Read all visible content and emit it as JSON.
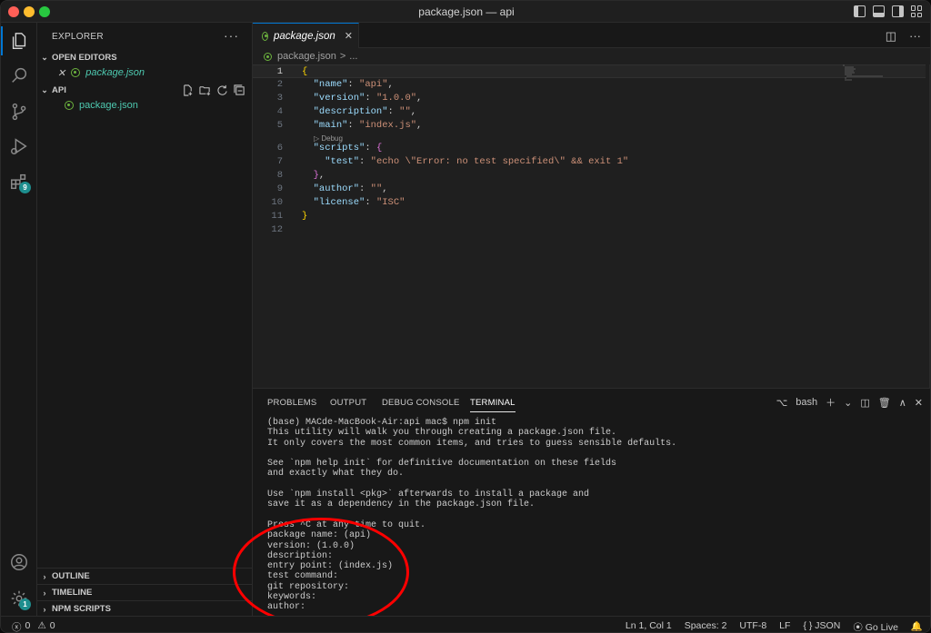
{
  "window": {
    "title": "package.json — api"
  },
  "activity": {
    "extensions_badge": "9",
    "manage_badge": "1"
  },
  "sidebar": {
    "header": "EXPLORER",
    "more": "···",
    "open_editors": {
      "label": "OPEN EDITORS",
      "file": "package.json"
    },
    "folder": {
      "label": "API",
      "file": "package.json"
    },
    "bottom": [
      "OUTLINE",
      "TIMELINE",
      "NPM SCRIPTS"
    ]
  },
  "editor": {
    "tab_label": "package.json",
    "breadcrumb": {
      "file": "package.json",
      "sep": ">",
      "rest": "..."
    },
    "codelens": "▷ Debug",
    "line_numbers": [
      "1",
      "2",
      "3",
      "4",
      "5",
      "6",
      "7",
      "8",
      "9",
      "10",
      "11",
      "12"
    ],
    "lines": {
      "l1": "{",
      "l2_key": "\"name\"",
      "l2_val": "\"api\"",
      "l3_key": "\"version\"",
      "l3_val": "\"1.0.0\"",
      "l4_key": "\"description\"",
      "l4_val": "\"\"",
      "l5_key": "\"main\"",
      "l5_val": "\"index.js\"",
      "l6_key": "\"scripts\"",
      "l6_brace": "{",
      "l7_key": "\"test\"",
      "l7_val": "\"echo \\\"Error: no test specified\\\" && exit 1\"",
      "l8": "}",
      "l9_key": "\"author\"",
      "l9_val": "\"\"",
      "l10_key": "\"license\"",
      "l10_val": "\"ISC\"",
      "l11": "}"
    }
  },
  "panel": {
    "tabs": [
      "PROBLEMS",
      "OUTPUT",
      "DEBUG CONSOLE",
      "TERMINAL"
    ],
    "shell": "bash",
    "terminal_lines": [
      "(base) MACde-MacBook-Air:api mac$ npm init",
      "This utility will walk you through creating a package.json file.",
      "It only covers the most common items, and tries to guess sensible defaults.",
      "",
      "See `npm help init` for definitive documentation on these fields",
      "and exactly what they do.",
      "",
      "Use `npm install <pkg>` afterwards to install a package and",
      "save it as a dependency in the package.json file.",
      "",
      "Press ^C at any time to quit.",
      "package name: (api)",
      "version: (1.0.0)",
      "description:",
      "entry point: (index.js)",
      "test command:",
      "git repository:",
      "keywords:",
      "author:"
    ]
  },
  "status": {
    "errors": "0",
    "warnings": "0",
    "position": "Ln 1, Col 1",
    "spaces": "Spaces: 2",
    "encoding": "UTF-8",
    "eol": "LF",
    "language": "JSON",
    "golive": "Go Live"
  },
  "colors": {
    "accent": "#0078d4",
    "annotation": "#ff0000",
    "json_icon": "#6cb33e"
  }
}
